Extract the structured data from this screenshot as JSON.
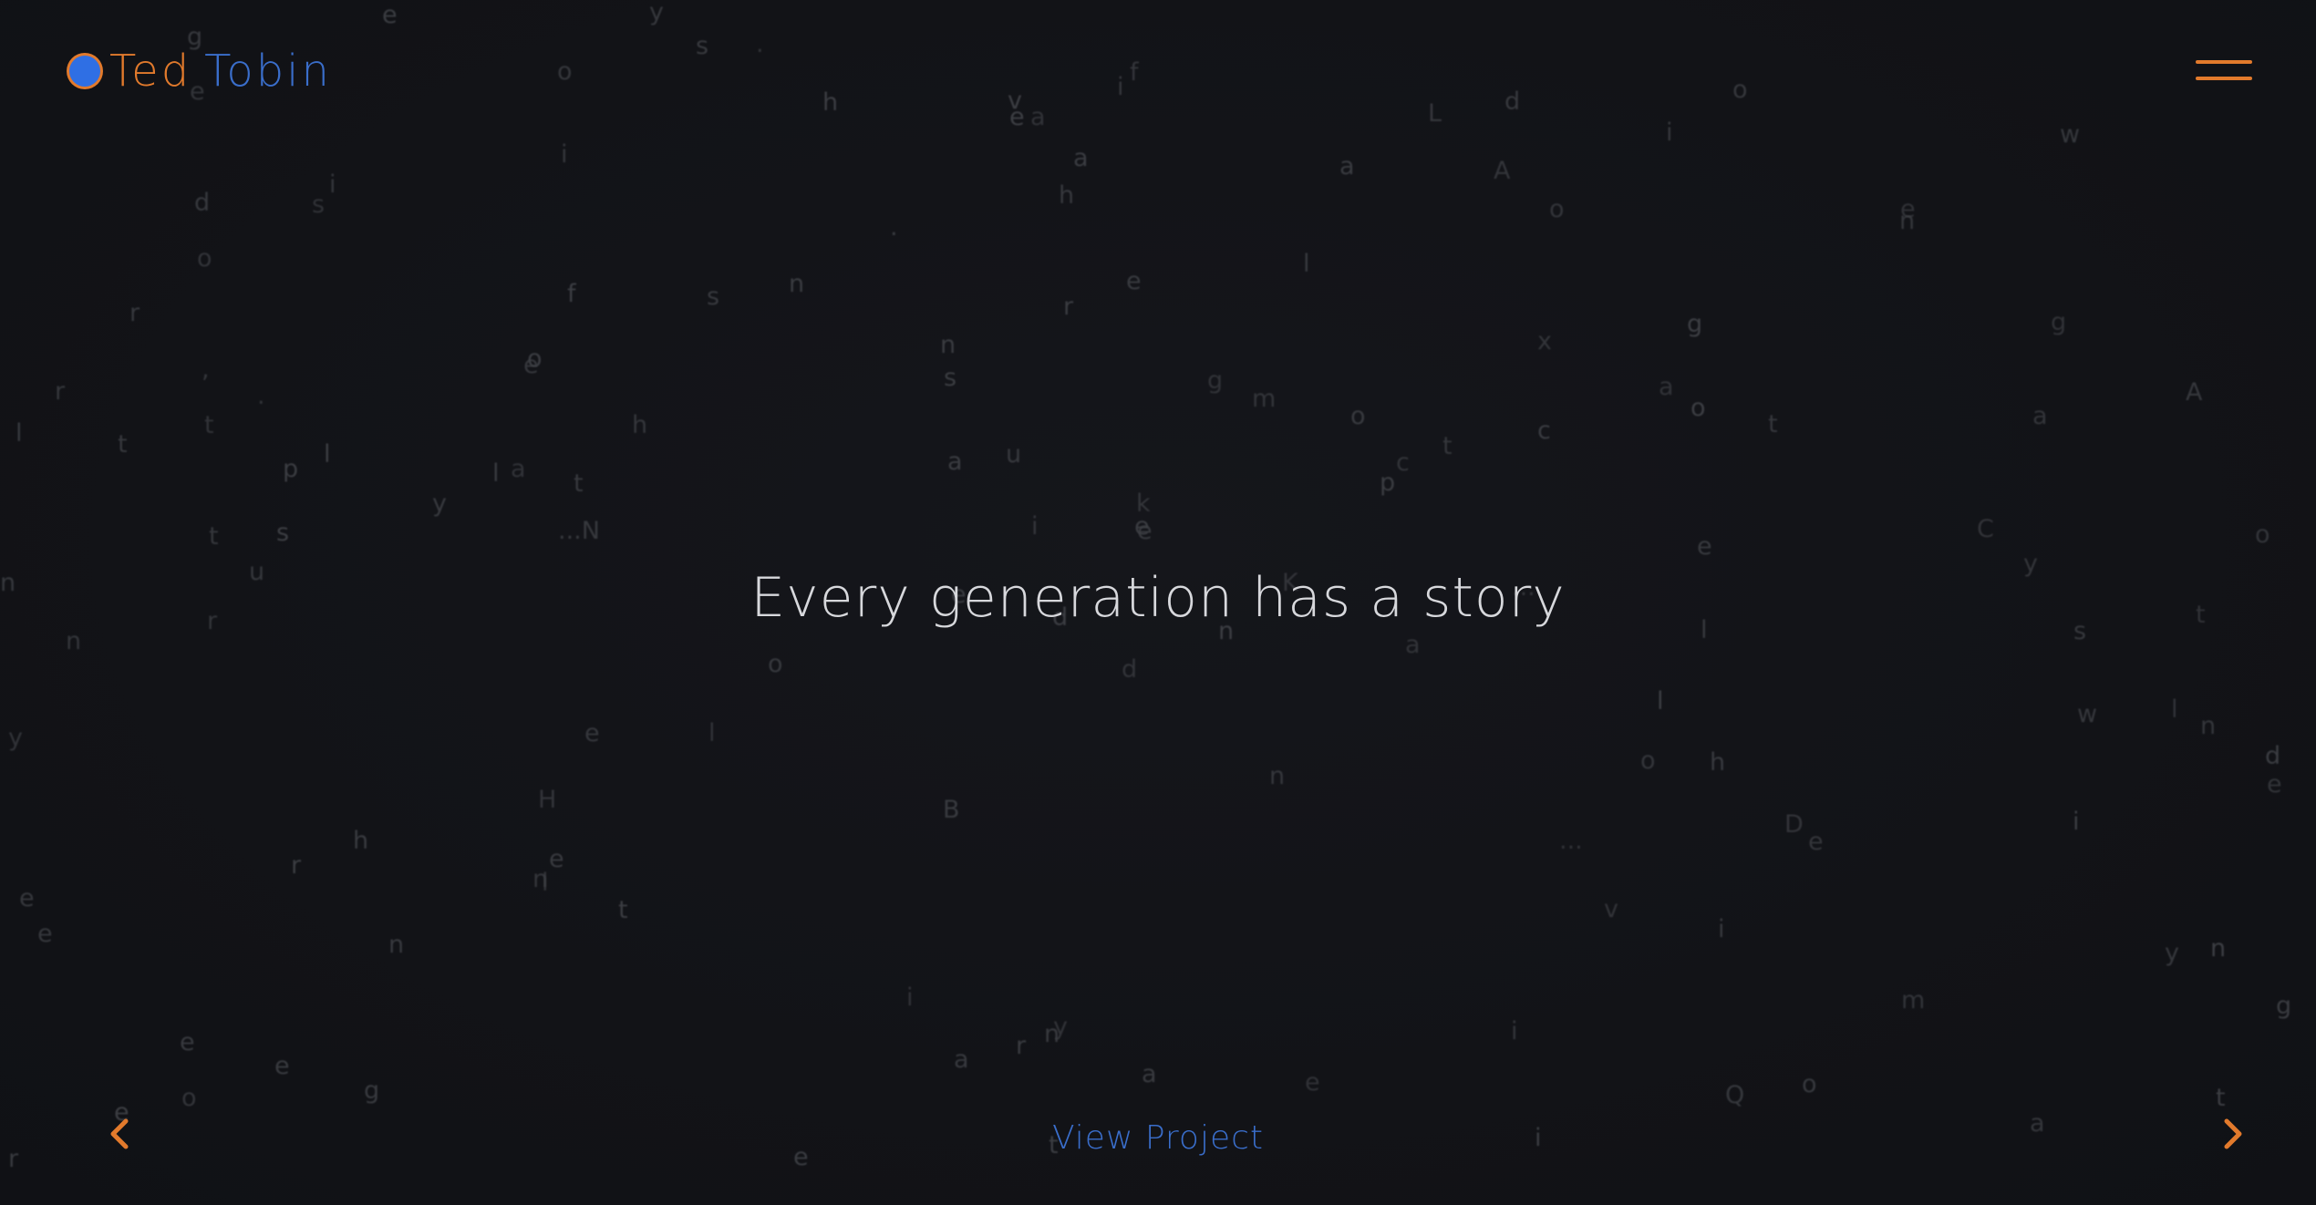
{
  "brand": {
    "first_name": "Ted",
    "last_name": "Tobin",
    "dot_icon": "circle-logo-icon"
  },
  "header": {
    "menu_icon": "hamburger-menu-icon"
  },
  "hero": {
    "headline": "Every generation has a story"
  },
  "footer_nav": {
    "prev_icon": "chevron-left-icon",
    "next_icon": "chevron-right-icon",
    "view_project_label": "View Project"
  },
  "background_letters": [
    "d",
    "...N",
    "e",
    "n",
    "d",
    "H",
    "K",
    "e",
    "s",
    "y",
    "x",
    "o",
    "m",
    "t",
    "o",
    "y",
    "p",
    "A",
    "a",
    "B",
    "A",
    "e",
    "i",
    "l",
    "t",
    "t",
    "h",
    "r",
    "l",
    "g",
    "l",
    "e",
    "n",
    "a",
    "g",
    "h",
    "i",
    "e",
    "g",
    "m",
    "f",
    "i",
    "o",
    "s",
    "L",
    "u",
    "e",
    "o",
    "o",
    "h",
    "e",
    "s",
    "u",
    "s",
    "e",
    "a",
    "t",
    "e",
    "o",
    "d",
    "v",
    "n",
    "i",
    "r",
    "t",
    "e",
    "o",
    "g",
    "t",
    ".",
    "n",
    "w",
    "n",
    "a",
    "d",
    "t",
    ".",
    "e",
    "w",
    "a",
    "r",
    "n",
    "n",
    "e",
    "a",
    "y",
    "o",
    "l",
    "h",
    "g",
    "e",
    "a",
    "n",
    "o",
    "p",
    "l",
    "c",
    "l",
    "Q",
    "C",
    "a",
    "o",
    "e",
    "a",
    "h",
    "s",
    "l",
    "...",
    "n",
    "y",
    ",",
    "i",
    "e",
    "g",
    "e",
    "l",
    "t",
    "l",
    "...",
    "i",
    "r",
    "n",
    "t",
    "i",
    ".",
    "s",
    "d",
    "c",
    "r",
    "e",
    "y",
    "k",
    "D",
    "i",
    "o",
    "y",
    "a",
    "e",
    "e",
    "v",
    "n",
    "e",
    "i",
    "a",
    "n",
    "o",
    "t",
    "r",
    "r",
    "f",
    "e",
    "i"
  ]
}
